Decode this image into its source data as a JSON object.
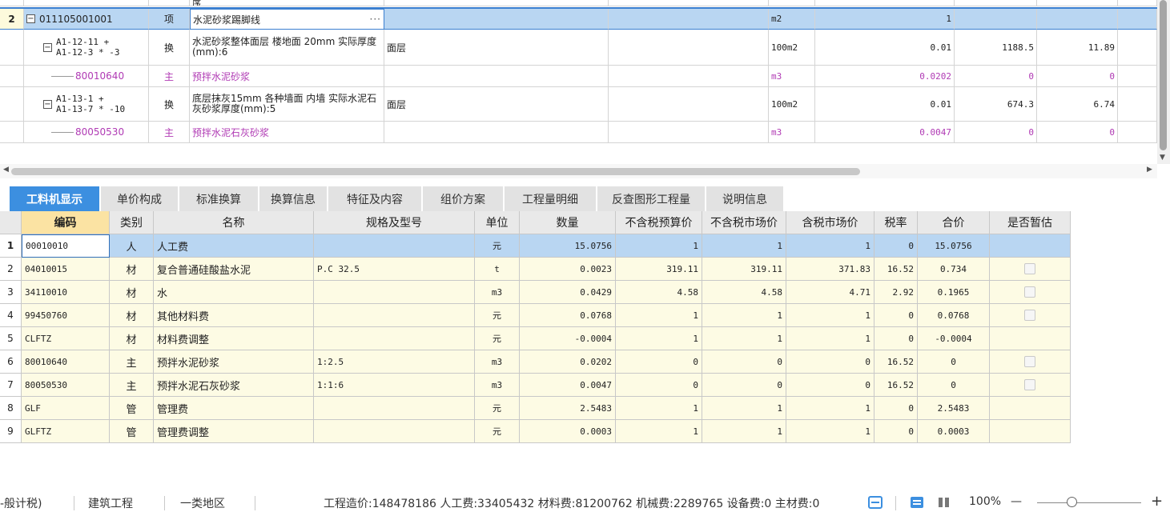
{
  "top_grid": {
    "partial_row_text": "序",
    "rows": [
      {
        "idx": "2",
        "code": "011105001001",
        "type": "项",
        "name": "水泥砂浆踢脚线",
        "feature": "",
        "unit": "m2",
        "qty": "1",
        "p1": "",
        "p2": "",
        "selected": true,
        "kind": "item"
      },
      {
        "idx": "",
        "code_line1": "A1-12-11 +",
        "code_line2": "A1-12-3 * -3",
        "type": "换",
        "name": "水泥砂浆整体面层 楼地面 20mm 实际厚度(mm):6",
        "feature": "面层",
        "unit": "100m2",
        "qty": "0.01",
        "p1": "1188.5",
        "p2": "11.89",
        "kind": "sub"
      },
      {
        "idx": "",
        "code": "80010640",
        "type": "主",
        "name": "预拌水泥砂浆",
        "feature": "",
        "unit": "m3",
        "qty": "0.0202",
        "p1": "0",
        "p2": "0",
        "kind": "main"
      },
      {
        "idx": "",
        "code_line1": "A1-13-1 +",
        "code_line2": "A1-13-7 * -10",
        "type": "换",
        "name": "底层抹灰15mm 各种墙面 内墙 实际水泥石灰砂浆厚度(mm):5",
        "feature": "面层",
        "unit": "100m2",
        "qty": "0.01",
        "p1": "674.3",
        "p2": "6.74",
        "kind": "sub"
      },
      {
        "idx": "",
        "code": "80050530",
        "type": "主",
        "name": "预拌水泥石灰砂浆",
        "feature": "",
        "unit": "m3",
        "qty": "0.0047",
        "p1": "0",
        "p2": "0",
        "kind": "main"
      }
    ],
    "more_icon": "ellipsis-icon"
  },
  "tabs": [
    "工料机显示",
    "单价构成",
    "标准换算",
    "换算信息",
    "特征及内容",
    "组价方案",
    "工程量明细",
    "反查图形工程量",
    "说明信息"
  ],
  "active_tab": 0,
  "table": {
    "headers": [
      "编码",
      "类别",
      "名称",
      "规格及型号",
      "单位",
      "数量",
      "不含税预算价",
      "不含税市场价",
      "含税市场价",
      "税率",
      "合价",
      "是否暂估"
    ],
    "rows": [
      {
        "idx": "1",
        "code": "00010010",
        "cat": "人",
        "name": "人工费",
        "spec": "",
        "unit": "元",
        "qty": "15.0756",
        "p1": "1",
        "p2": "1",
        "p3": "1",
        "rate": "0",
        "total": "15.0756",
        "chk": false
      },
      {
        "idx": "2",
        "code": "04010015",
        "cat": "材",
        "name": "复合普通硅酸盐水泥",
        "spec": "P.C 32.5",
        "unit": "t",
        "qty": "0.0023",
        "p1": "319.11",
        "p2": "319.11",
        "p3": "371.83",
        "rate": "16.52",
        "total": "0.734",
        "chk": true
      },
      {
        "idx": "3",
        "code": "34110010",
        "cat": "材",
        "name": "水",
        "spec": "",
        "unit": "m3",
        "qty": "0.0429",
        "p1": "4.58",
        "p2": "4.58",
        "p3": "4.71",
        "rate": "2.92",
        "total": "0.1965",
        "chk": true
      },
      {
        "idx": "4",
        "code": "99450760",
        "cat": "材",
        "name": "其他材料费",
        "spec": "",
        "unit": "元",
        "qty": "0.0768",
        "p1": "1",
        "p2": "1",
        "p3": "1",
        "rate": "0",
        "total": "0.0768",
        "chk": true
      },
      {
        "idx": "5",
        "code": "CLFTZ",
        "cat": "材",
        "name": "材料费调整",
        "spec": "",
        "unit": "元",
        "qty": "-0.0004",
        "p1": "1",
        "p2": "1",
        "p3": "1",
        "rate": "0",
        "total": "-0.0004",
        "chk": false
      },
      {
        "idx": "6",
        "code": "80010640",
        "cat": "主",
        "name": "预拌水泥砂浆",
        "spec": "1:2.5",
        "unit": "m3",
        "qty": "0.0202",
        "p1": "0",
        "p2": "0",
        "p3": "0",
        "rate": "16.52",
        "total": "0",
        "chk": true
      },
      {
        "idx": "7",
        "code": "80050530",
        "cat": "主",
        "name": "预拌水泥石灰砂浆",
        "spec": "1:1:6",
        "unit": "m3",
        "qty": "0.0047",
        "p1": "0",
        "p2": "0",
        "p3": "0",
        "rate": "16.52",
        "total": "0",
        "chk": true
      },
      {
        "idx": "8",
        "code": "GLF",
        "cat": "管",
        "name": "管理费",
        "spec": "",
        "unit": "元",
        "qty": "2.5483",
        "p1": "1",
        "p2": "1",
        "p3": "1",
        "rate": "0",
        "total": "2.5483",
        "chk": false
      },
      {
        "idx": "9",
        "code": "GLFTZ",
        "cat": "管",
        "name": "管理费调整",
        "spec": "",
        "unit": "元",
        "qty": "0.0003",
        "p1": "1",
        "p2": "1",
        "p3": "1",
        "rate": "0",
        "total": "0.0003",
        "chk": false
      }
    ]
  },
  "status": {
    "tax_mode": "-般计税)",
    "discipline": "建筑工程",
    "region": "一类地区",
    "summary": "工程造价:148478186  人工费:33405432  材料费:81200762  机械费:2289765  设备费:0  主材费:0",
    "zoom": "100%",
    "zoom_out": "—",
    "zoom_in": "+"
  },
  "colors": {
    "accent": "#3c8fe0",
    "selected_row": "#b9d6f2",
    "yellow_cell": "#fdfbe4",
    "purple_text": "#b03ab4"
  }
}
